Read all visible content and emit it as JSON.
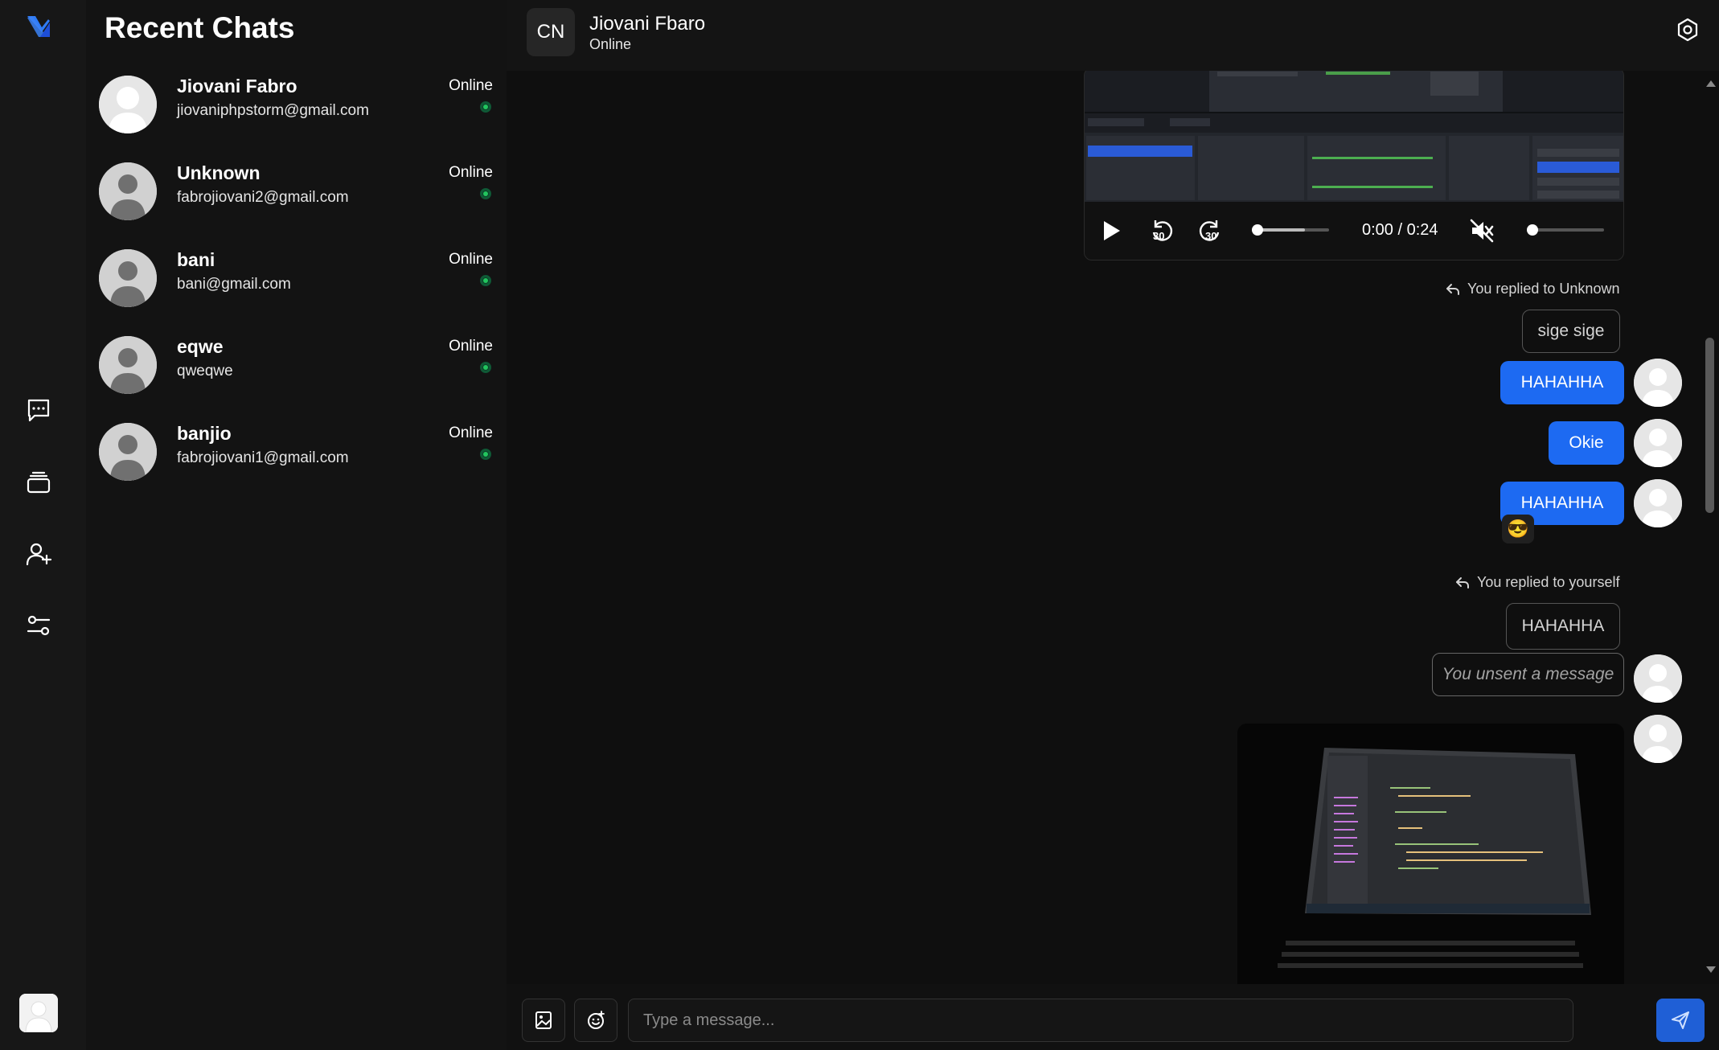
{
  "sidebar": {
    "logo_icon": "app-logo-icon",
    "nav": [
      {
        "icon": "chat-bubble-icon"
      },
      {
        "icon": "stack-icon"
      },
      {
        "icon": "add-user-icon"
      },
      {
        "icon": "sliders-icon"
      }
    ],
    "accent": "#2f7bf5"
  },
  "recent_chats": {
    "title": "Recent Chats",
    "items": [
      {
        "name": "Jiovani Fabro",
        "email": "jiovaniphpstorm@gmail.com",
        "status": "Online"
      },
      {
        "name": "Unknown",
        "email": "fabrojiovani2@gmail.com",
        "status": "Online"
      },
      {
        "name": "bani",
        "email": "bani@gmail.com",
        "status": "Online"
      },
      {
        "name": "eqwe",
        "email": "qweqwe",
        "status": "Online"
      },
      {
        "name": "banjio",
        "email": "fabrojiovani1@gmail.com",
        "status": "Online"
      }
    ]
  },
  "conversation": {
    "header": {
      "initials": "CN",
      "name": "Jiovani Fbaro",
      "status": "Online"
    },
    "video": {
      "time": "0:00 / 0:24",
      "rewind_label": "30",
      "forward_label": "30",
      "progress": 0.0,
      "volume": 0.0,
      "muted": true
    },
    "messages": {
      "reply1_note": "You replied to Unknown",
      "reply1_quote": "sige sige",
      "msg1": "HAHAHHA",
      "msg2": "Okie",
      "msg3": "HAHAHHA",
      "msg3_reaction": "😎",
      "reply2_note": "You replied to yourself",
      "reply2_quote": "HAHAHHA",
      "unsent": "You unsent a message"
    },
    "composer": {
      "placeholder": "Type a message..."
    },
    "colors": {
      "sent_bubble": "#1d6af2",
      "online_dot": "#22c55e"
    }
  }
}
